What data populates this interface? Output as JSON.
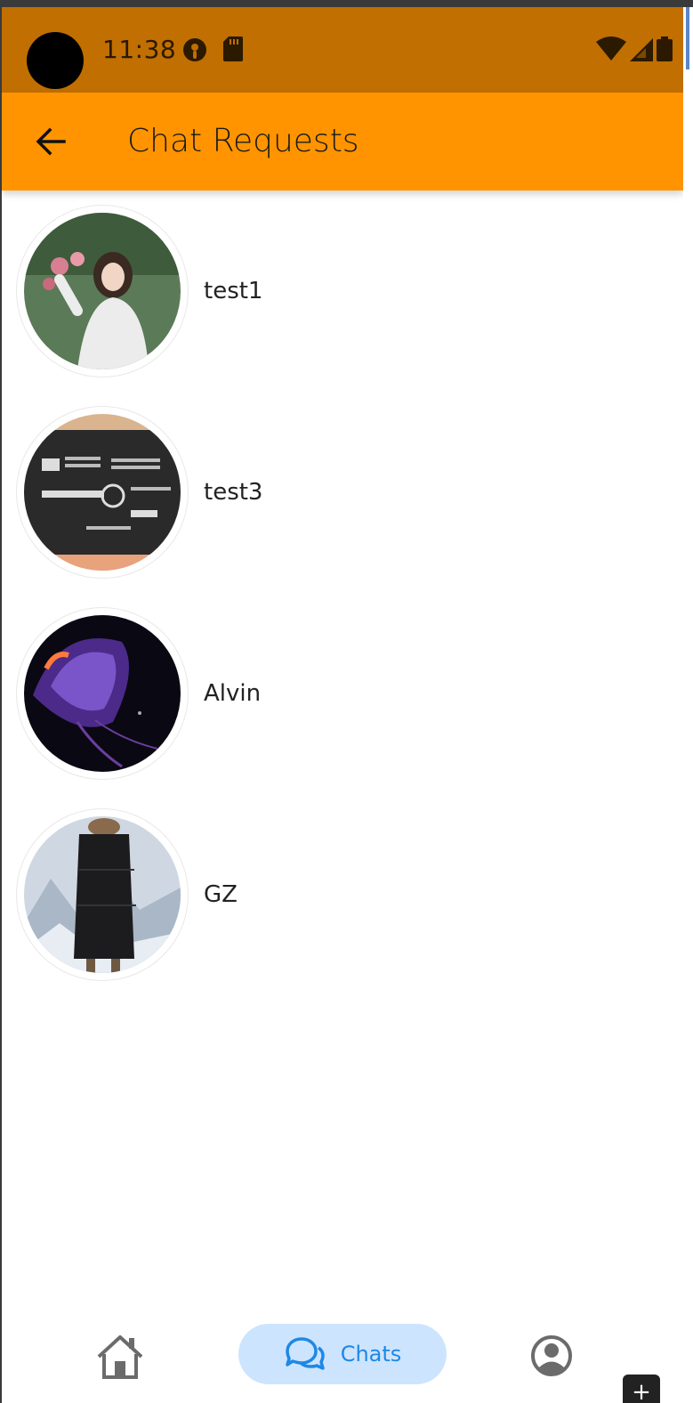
{
  "status_bar": {
    "time": "11:38",
    "left_icons": [
      "podcast-icon",
      "sd-card-icon"
    ],
    "right_icons": [
      "wifi-icon",
      "signal-icon",
      "battery-icon"
    ],
    "background": "#c06f00"
  },
  "app_bar": {
    "title": "Chat Requests",
    "back_icon": "arrow-left-icon",
    "background": "#ff9400"
  },
  "requests": [
    {
      "name": "test1",
      "avatar": "photo-woman-with-flowers"
    },
    {
      "name": "test3",
      "avatar": "photo-power-adapter-label"
    },
    {
      "name": "Alvin",
      "avatar": "photo-jellyfish"
    },
    {
      "name": "GZ",
      "avatar": "photo-black-winter-coat"
    }
  ],
  "bottom_nav": {
    "items": [
      {
        "icon": "home-icon",
        "label": ""
      },
      {
        "icon": "chat-bubbles-icon",
        "label": "Chats",
        "active": true
      },
      {
        "icon": "account-circle-icon",
        "label": ""
      }
    ],
    "active_color": "#1e88e5",
    "active_bg": "#cde4ff"
  },
  "fab": {
    "label": "+"
  }
}
